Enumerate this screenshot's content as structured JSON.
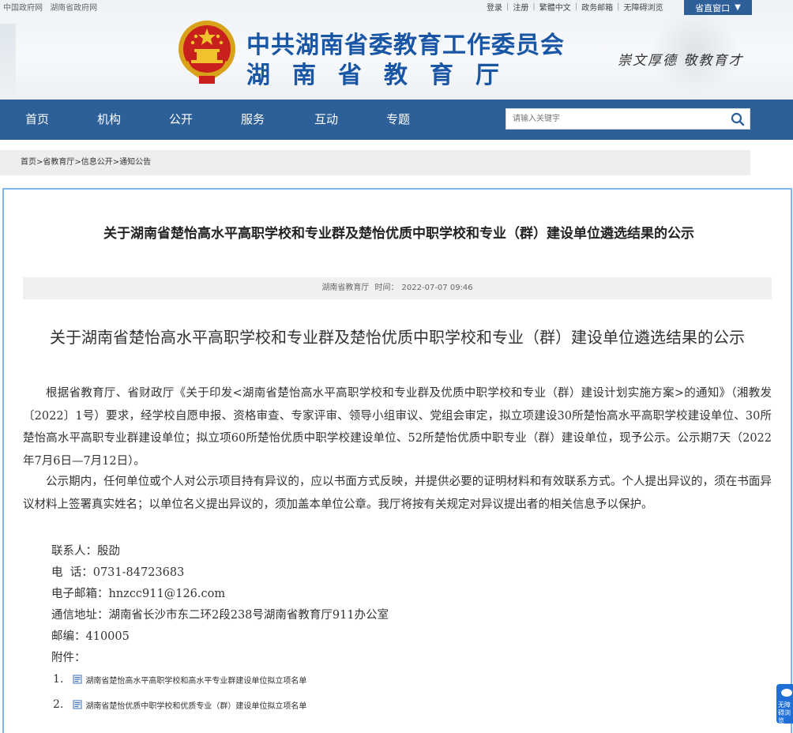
{
  "top_left_links": [
    "中国政府网",
    "湖南省政府网"
  ],
  "top_links": [
    "登录",
    "注册",
    "繁體中文",
    "政务邮箱",
    "无障碍浏览"
  ],
  "province_window": {
    "label": "省直窗口",
    "arrow": "▼"
  },
  "header": {
    "title_line1": "中共湖南省委教育工作委员会",
    "title_line2": "湖南省教育厅",
    "motto": "崇文厚德  敬教育才"
  },
  "nav": {
    "items": [
      "首页",
      "机构",
      "公开",
      "服务",
      "互动",
      "专题"
    ]
  },
  "search": {
    "placeholder": "请输入关键字",
    "icon": "search-icon"
  },
  "breadcrumb": "首页>省教育厅>信息公开>通知公告",
  "article": {
    "title": "关于湖南省楚怡高水平高职学校和专业群及楚怡优质中职学校和专业（群）建设单位遴选结果的公示",
    "source": "湖南省教育厅",
    "time_label": "时间：",
    "time": "2022-07-07 09:46",
    "body_title": "关于湖南省楚怡高水平高职学校和专业群及楚怡优质中职学校和专业（群）建设单位遴选结果的公示",
    "para1": "根据省教育厅、省财政厅《关于印发<湖南省楚怡高水平高职学校和专业群及优质中职学校和专业（群）建设计划实施方案>的通知》（湘教发〔2022〕1号）要求，经学校自愿申报、资格审查、专家评审、领导小组审议、党组会审定，拟立项建设30所楚怡高水平高职学校建设单位、30所楚怡高水平高职专业群建设单位；拟立项60所楚怡优质中职学校建设单位、52所楚怡优质中职专业（群）建设单位，现予公示。公示期7天（2022年7月6日—7月12日）。",
    "para2": "公示期内，任何单位或个人对公示项目持有异议的，应以书面方式反映，并提供必要的证明材料和有效联系方式。个人提出异议的，须在书面异议材料上签署真实姓名；以单位名义提出异议的，须加盖本单位公章。我厅将按有关规定对异议提出者的相关信息予以保护。",
    "contact": "联系人：殷劭",
    "phone": "电  话：0731-84723683",
    "email": "电子邮箱：hnzcc911@126.com",
    "address": "通信地址：湖南省长沙市东二环2段238号湖南省教育厅911办公室",
    "postcode": "邮编：410005",
    "attachments_label": "附件：",
    "attachments": [
      {
        "num": "1.",
        "name": "湖南省楚怡高水平高职学校和高水平专业群建设单位拟立项名单"
      },
      {
        "num": "2.",
        "name": "湖南省楚怡优质中职学校和优质专业（群）建设单位拟立项名单"
      }
    ]
  },
  "accessibility_badge": "无障碍浏览"
}
